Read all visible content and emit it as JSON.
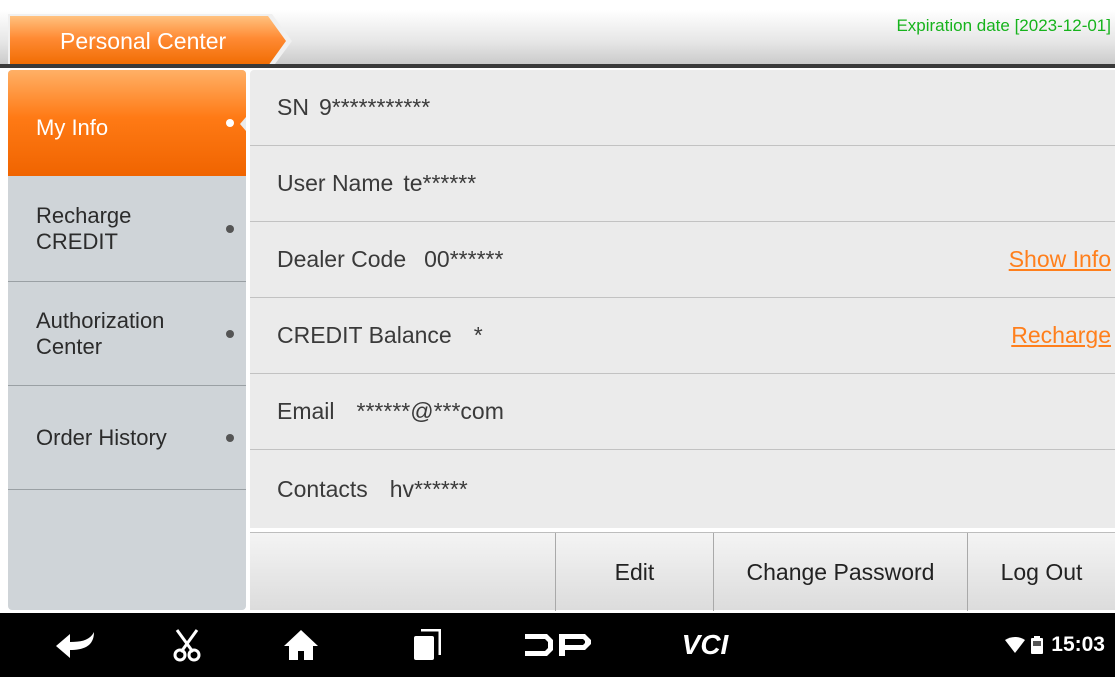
{
  "header": {
    "title": "Personal Center",
    "expiration": "Expiration date [2023-12-01]"
  },
  "sidebar": {
    "items": [
      {
        "label": "My Info",
        "active": true
      },
      {
        "label": "Recharge\nCREDIT",
        "active": false
      },
      {
        "label": "Authorization\nCenter",
        "active": false
      },
      {
        "label": "Order History",
        "active": false
      }
    ]
  },
  "info": {
    "rows": [
      {
        "label": "SN",
        "value": "9***********"
      },
      {
        "label": "User Name",
        "value": "te******"
      },
      {
        "label": "Dealer Code",
        "value": "00******",
        "link": "Show Info"
      },
      {
        "label": "CREDIT Balance",
        "value": "*",
        "link": "Recharge"
      },
      {
        "label": "Email",
        "value": "******@***com"
      },
      {
        "label": "Contacts",
        "value": "hv******"
      }
    ]
  },
  "actions": {
    "edit": "Edit",
    "change_password": "Change Password",
    "log_out": "Log Out"
  },
  "navbar": {
    "icons": [
      "back-icon",
      "scissors-icon",
      "home-icon",
      "recents-icon",
      "dp-logo-icon",
      "vci-icon"
    ],
    "vci_text": "VCI",
    "time": "15:03"
  },
  "colors": {
    "accent": "#ff7f1c",
    "expiration": "#16b31c",
    "sidebar_bg": "#cfd4d8",
    "panel_bg": "#ebebeb"
  }
}
